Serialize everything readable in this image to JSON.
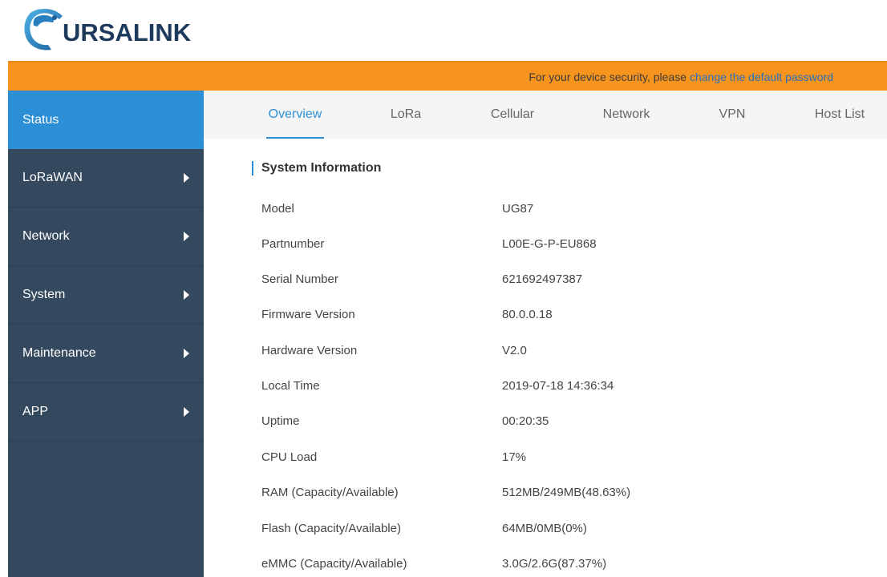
{
  "brand": {
    "name": "URSALINK"
  },
  "notice": {
    "text": "For your device security, please",
    "link": "change the default password"
  },
  "sidebar": {
    "items": [
      {
        "label": "Status",
        "active": true,
        "has_arrow": false
      },
      {
        "label": "LoRaWAN",
        "active": false,
        "has_arrow": true
      },
      {
        "label": "Network",
        "active": false,
        "has_arrow": true
      },
      {
        "label": "System",
        "active": false,
        "has_arrow": true
      },
      {
        "label": "Maintenance",
        "active": false,
        "has_arrow": true
      },
      {
        "label": "APP",
        "active": false,
        "has_arrow": true
      }
    ]
  },
  "tabs": [
    {
      "label": "Overview",
      "active": true
    },
    {
      "label": "LoRa",
      "active": false
    },
    {
      "label": "Cellular",
      "active": false
    },
    {
      "label": "Network",
      "active": false
    },
    {
      "label": "VPN",
      "active": false
    },
    {
      "label": "Host List",
      "active": false
    }
  ],
  "section": {
    "title": "System Information"
  },
  "system_info": [
    {
      "label": "Model",
      "value": "UG87"
    },
    {
      "label": "Partnumber",
      "value": "L00E-G-P-EU868"
    },
    {
      "label": "Serial Number",
      "value": "621692497387"
    },
    {
      "label": "Firmware Version",
      "value": "80.0.0.18"
    },
    {
      "label": "Hardware Version",
      "value": "V2.0"
    },
    {
      "label": "Local Time",
      "value": "2019-07-18 14:36:34"
    },
    {
      "label": "Uptime",
      "value": "00:20:35"
    },
    {
      "label": "CPU Load",
      "value": "17%"
    },
    {
      "label": "RAM (Capacity/Available)",
      "value": "512MB/249MB(48.63%)"
    },
    {
      "label": "Flash (Capacity/Available)",
      "value": "64MB/0MB(0%)"
    },
    {
      "label": "eMMC (Capacity/Available)",
      "value": "3.0G/2.6G(87.37%)"
    }
  ],
  "colors": {
    "accent": "#2c8fd6",
    "notice_bg": "#f7941d",
    "sidebar_bg": "#34495e",
    "link": "#2a6fb8"
  }
}
